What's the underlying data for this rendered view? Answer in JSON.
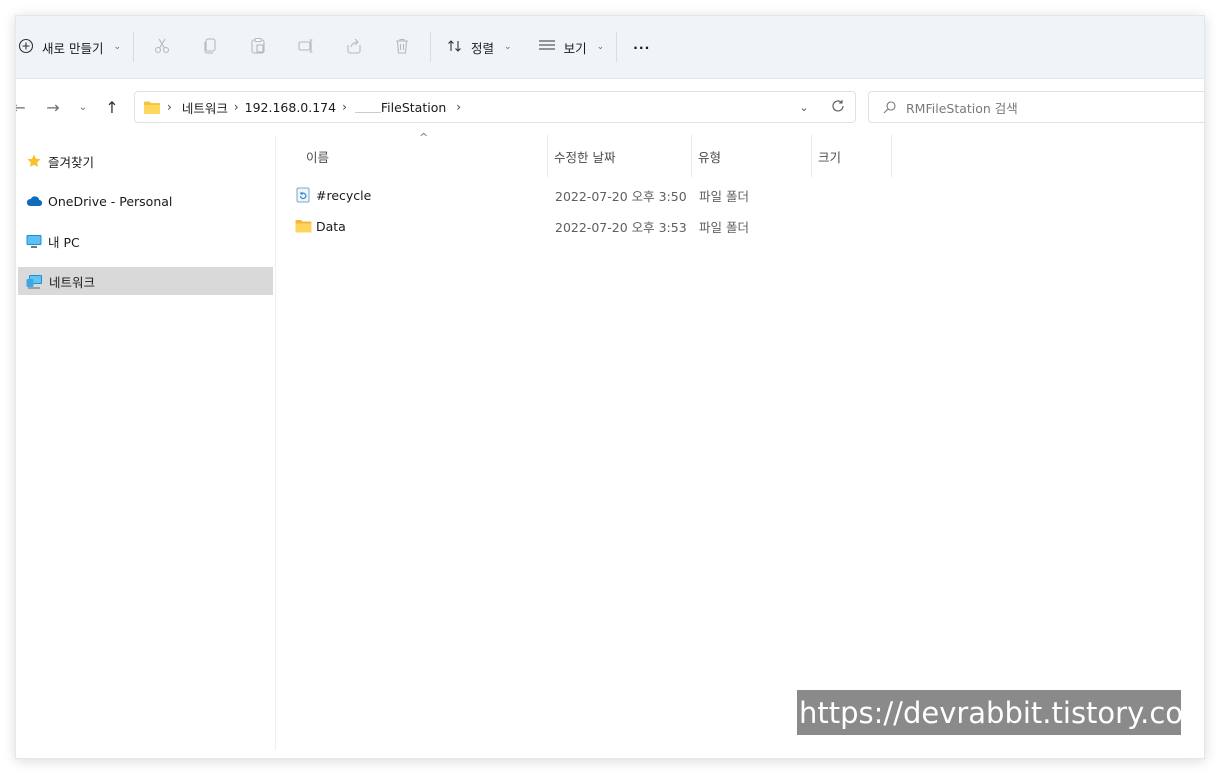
{
  "toolbar": {
    "new_label": "새로 만들기",
    "sort_label": "정렬",
    "view_label": "보기",
    "more_label": "···"
  },
  "address": {
    "crumbs": [
      "네트워크",
      "192.168.0.174",
      "FileStation"
    ]
  },
  "search": {
    "placeholder": "RMFileStation 검색"
  },
  "sidebar": {
    "items": [
      {
        "label": "즐겨찾기"
      },
      {
        "label": "OneDrive - Personal"
      },
      {
        "label": "내 PC"
      },
      {
        "label": "네트워크"
      }
    ]
  },
  "columns": {
    "name": "이름",
    "modified": "수정한 날짜",
    "type": "유형",
    "size": "크기"
  },
  "files": [
    {
      "name": "#recycle",
      "modified": "2022-07-20 오후 3:50",
      "type": "파일 폴더",
      "size": ""
    },
    {
      "name": "Data",
      "modified": "2022-07-20 오후 3:53",
      "type": "파일 폴더",
      "size": ""
    }
  ],
  "watermark": "https://devrabbit.tistory.com",
  "colors": {
    "toolbar_bg": "#eff4f9",
    "folder": "#f5c542",
    "selected": "#d9d9d9"
  }
}
